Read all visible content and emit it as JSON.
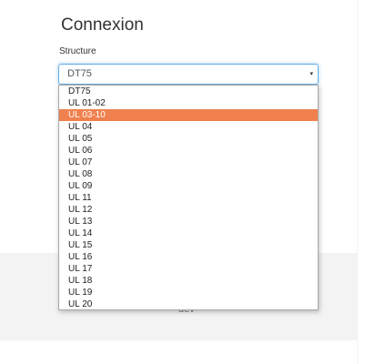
{
  "page": {
    "title": "Connexion",
    "footer_text": "dev"
  },
  "form": {
    "structure_label": "Structure",
    "structure_value": "DT75",
    "caret": "▾"
  },
  "colors": {
    "highlight": "#f0814e",
    "focus_border": "#66afe9",
    "footer_bg": "#f3f3f3"
  },
  "dropdown": {
    "options": [
      {
        "label": "DT75"
      },
      {
        "label": "UL 01-02"
      },
      {
        "label": "UL 03-10",
        "selected": true
      },
      {
        "label": "UL 04"
      },
      {
        "label": "UL 05"
      },
      {
        "label": "UL 06"
      },
      {
        "label": "UL 07"
      },
      {
        "label": "UL 08"
      },
      {
        "label": "UL 09"
      },
      {
        "label": "UL 11"
      },
      {
        "label": "UL 12"
      },
      {
        "label": "UL 13"
      },
      {
        "label": "UL 14"
      },
      {
        "label": "UL 15"
      },
      {
        "label": "UL 16"
      },
      {
        "label": "UL 17"
      },
      {
        "label": "UL 18"
      },
      {
        "label": "UL 19"
      },
      {
        "label": "UL 20"
      }
    ]
  }
}
